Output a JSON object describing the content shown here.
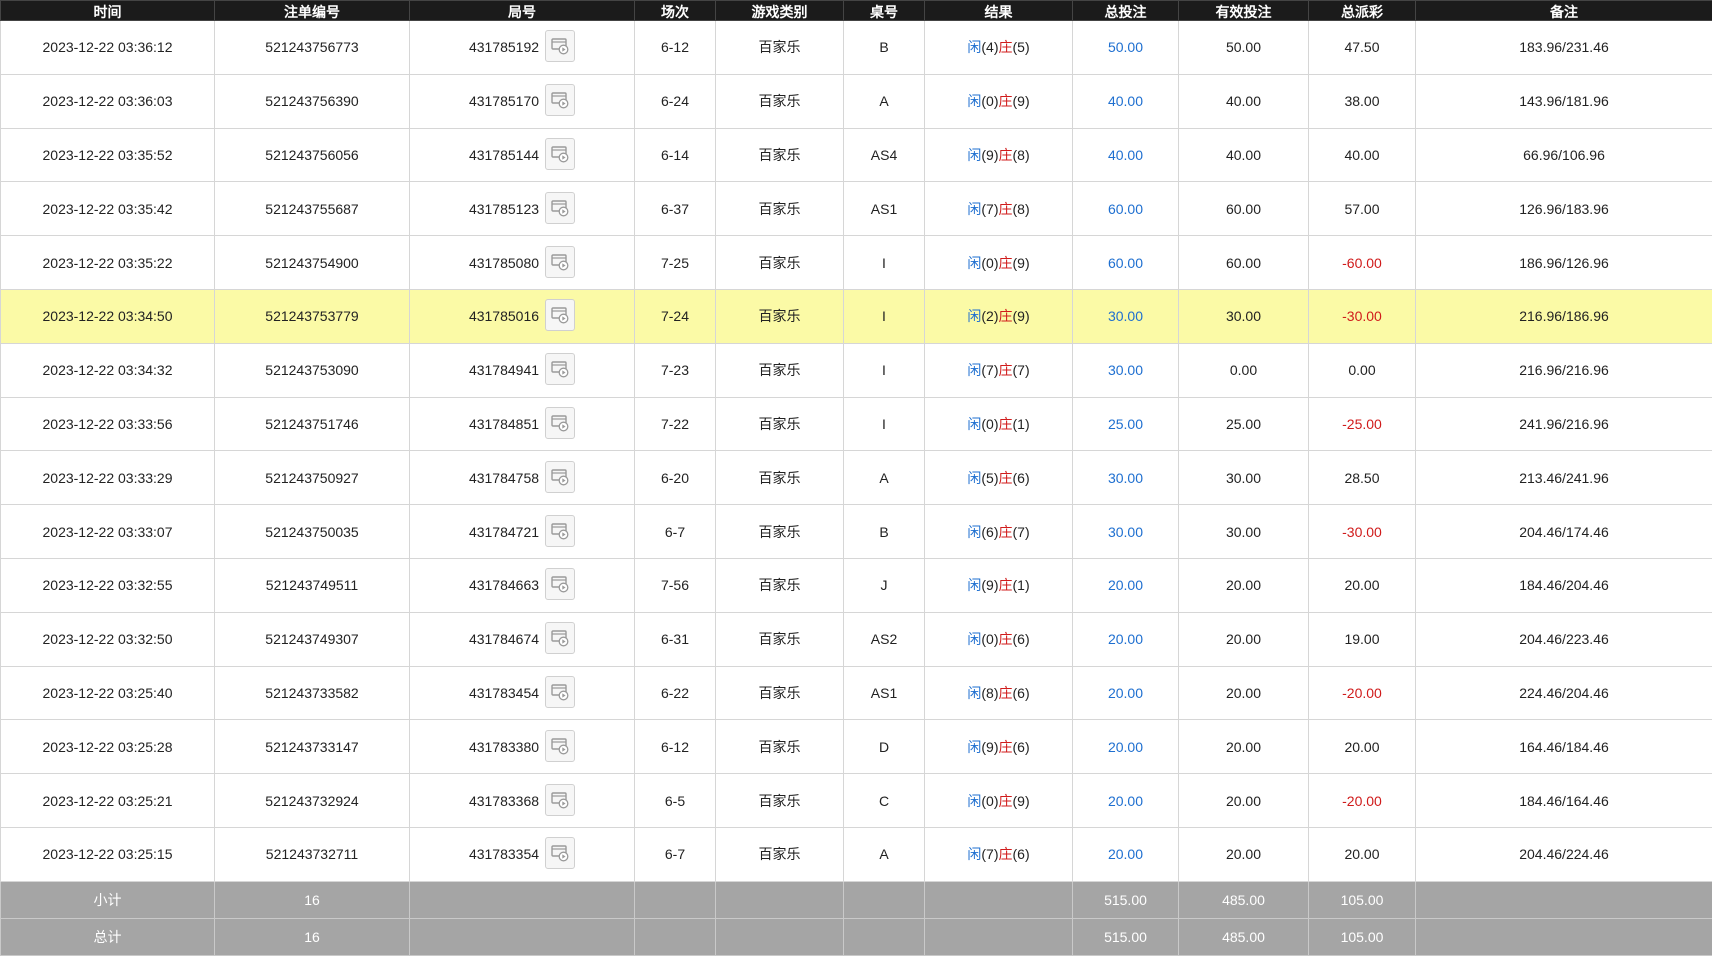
{
  "headers": [
    "时间",
    "注单编号",
    "局号",
    "场次",
    "游戏类别",
    "桌号",
    "结果",
    "总投注",
    "有效投注",
    "总派彩",
    "备注"
  ],
  "rows": [
    {
      "time": "2023-12-22 03:36:12",
      "order": "521243756773",
      "round": "431785192",
      "session": "6-12",
      "game": "百家乐",
      "table": "B",
      "player_label": "闲",
      "player": "(4)",
      "banker_label": "庄",
      "banker": "(5)",
      "bet": "50.00",
      "valid": "50.00",
      "payout": "47.50",
      "payout_neg": false,
      "note": "183.96/231.46",
      "highlight": false
    },
    {
      "time": "2023-12-22 03:36:03",
      "order": "521243756390",
      "round": "431785170",
      "session": "6-24",
      "game": "百家乐",
      "table": "A",
      "player_label": "闲",
      "player": "(0)",
      "banker_label": "庄",
      "banker": "(9)",
      "bet": "40.00",
      "valid": "40.00",
      "payout": "38.00",
      "payout_neg": false,
      "note": "143.96/181.96",
      "highlight": false
    },
    {
      "time": "2023-12-22 03:35:52",
      "order": "521243756056",
      "round": "431785144",
      "session": "6-14",
      "game": "百家乐",
      "table": "AS4",
      "player_label": "闲",
      "player": "(9)",
      "banker_label": "庄",
      "banker": "(8)",
      "bet": "40.00",
      "valid": "40.00",
      "payout": "40.00",
      "payout_neg": false,
      "note": "66.96/106.96",
      "highlight": false
    },
    {
      "time": "2023-12-22 03:35:42",
      "order": "521243755687",
      "round": "431785123",
      "session": "6-37",
      "game": "百家乐",
      "table": "AS1",
      "player_label": "闲",
      "player": "(7)",
      "banker_label": "庄",
      "banker": "(8)",
      "bet": "60.00",
      "valid": "60.00",
      "payout": "57.00",
      "payout_neg": false,
      "note": "126.96/183.96",
      "highlight": false
    },
    {
      "time": "2023-12-22 03:35:22",
      "order": "521243754900",
      "round": "431785080",
      "session": "7-25",
      "game": "百家乐",
      "table": "I",
      "player_label": "闲",
      "player": "(0)",
      "banker_label": "庄",
      "banker": "(9)",
      "bet": "60.00",
      "valid": "60.00",
      "payout": "-60.00",
      "payout_neg": true,
      "note": "186.96/126.96",
      "highlight": false
    },
    {
      "time": "2023-12-22 03:34:50",
      "order": "521243753779",
      "round": "431785016",
      "session": "7-24",
      "game": "百家乐",
      "table": "I",
      "player_label": "闲",
      "player": "(2)",
      "banker_label": "庄",
      "banker": "(9)",
      "bet": "30.00",
      "valid": "30.00",
      "payout": "-30.00",
      "payout_neg": true,
      "note": "216.96/186.96",
      "highlight": true
    },
    {
      "time": "2023-12-22 03:34:32",
      "order": "521243753090",
      "round": "431784941",
      "session": "7-23",
      "game": "百家乐",
      "table": "I",
      "player_label": "闲",
      "player": "(7)",
      "banker_label": "庄",
      "banker": "(7)",
      "bet": "30.00",
      "valid": "0.00",
      "payout": "0.00",
      "payout_neg": false,
      "note": "216.96/216.96",
      "highlight": false
    },
    {
      "time": "2023-12-22 03:33:56",
      "order": "521243751746",
      "round": "431784851",
      "session": "7-22",
      "game": "百家乐",
      "table": "I",
      "player_label": "闲",
      "player": "(0)",
      "banker_label": "庄",
      "banker": "(1)",
      "bet": "25.00",
      "valid": "25.00",
      "payout": "-25.00",
      "payout_neg": true,
      "note": "241.96/216.96",
      "highlight": false
    },
    {
      "time": "2023-12-22 03:33:29",
      "order": "521243750927",
      "round": "431784758",
      "session": "6-20",
      "game": "百家乐",
      "table": "A",
      "player_label": "闲",
      "player": "(5)",
      "banker_label": "庄",
      "banker": "(6)",
      "bet": "30.00",
      "valid": "30.00",
      "payout": "28.50",
      "payout_neg": false,
      "note": "213.46/241.96",
      "highlight": false
    },
    {
      "time": "2023-12-22 03:33:07",
      "order": "521243750035",
      "round": "431784721",
      "session": "6-7",
      "game": "百家乐",
      "table": "B",
      "player_label": "闲",
      "player": "(6)",
      "banker_label": "庄",
      "banker": "(7)",
      "bet": "30.00",
      "valid": "30.00",
      "payout": "-30.00",
      "payout_neg": true,
      "note": "204.46/174.46",
      "highlight": false
    },
    {
      "time": "2023-12-22 03:32:55",
      "order": "521243749511",
      "round": "431784663",
      "session": "7-56",
      "game": "百家乐",
      "table": "J",
      "player_label": "闲",
      "player": "(9)",
      "banker_label": "庄",
      "banker": "(1)",
      "bet": "20.00",
      "valid": "20.00",
      "payout": "20.00",
      "payout_neg": false,
      "note": "184.46/204.46",
      "highlight": false
    },
    {
      "time": "2023-12-22 03:32:50",
      "order": "521243749307",
      "round": "431784674",
      "session": "6-31",
      "game": "百家乐",
      "table": "AS2",
      "player_label": "闲",
      "player": "(0)",
      "banker_label": "庄",
      "banker": "(6)",
      "bet": "20.00",
      "valid": "20.00",
      "payout": "19.00",
      "payout_neg": false,
      "note": "204.46/223.46",
      "highlight": false
    },
    {
      "time": "2023-12-22 03:25:40",
      "order": "521243733582",
      "round": "431783454",
      "session": "6-22",
      "game": "百家乐",
      "table": "AS1",
      "player_label": "闲",
      "player": "(8)",
      "banker_label": "庄",
      "banker": "(6)",
      "bet": "20.00",
      "valid": "20.00",
      "payout": "-20.00",
      "payout_neg": true,
      "note": "224.46/204.46",
      "highlight": false
    },
    {
      "time": "2023-12-22 03:25:28",
      "order": "521243733147",
      "round": "431783380",
      "session": "6-12",
      "game": "百家乐",
      "table": "D",
      "player_label": "闲",
      "player": "(9)",
      "banker_label": "庄",
      "banker": "(6)",
      "bet": "20.00",
      "valid": "20.00",
      "payout": "20.00",
      "payout_neg": false,
      "note": "164.46/184.46",
      "highlight": false
    },
    {
      "time": "2023-12-22 03:25:21",
      "order": "521243732924",
      "round": "431783368",
      "session": "6-5",
      "game": "百家乐",
      "table": "C",
      "player_label": "闲",
      "player": "(0)",
      "banker_label": "庄",
      "banker": "(9)",
      "bet": "20.00",
      "valid": "20.00",
      "payout": "-20.00",
      "payout_neg": true,
      "note": "184.46/164.46",
      "highlight": false
    },
    {
      "time": "2023-12-22 03:25:15",
      "order": "521243732711",
      "round": "431783354",
      "session": "6-7",
      "game": "百家乐",
      "table": "A",
      "player_label": "闲",
      "player": "(7)",
      "banker_label": "庄",
      "banker": "(6)",
      "bet": "20.00",
      "valid": "20.00",
      "payout": "20.00",
      "payout_neg": false,
      "note": "204.46/224.46",
      "highlight": false
    }
  ],
  "subtotal": {
    "label": "小计",
    "count": "16",
    "bet": "515.00",
    "valid": "485.00",
    "payout": "105.00"
  },
  "total": {
    "label": "总计",
    "count": "16",
    "bet": "515.00",
    "valid": "485.00",
    "payout": "105.00"
  },
  "icons": {
    "replay": "video-replay-icon"
  },
  "colors": {
    "header_bg": "#1b1b1b",
    "highlight": "#fbfaa6",
    "blue": "#1e6fd0",
    "red": "#d01b1b",
    "summary_bg": "#a5a5a5"
  }
}
